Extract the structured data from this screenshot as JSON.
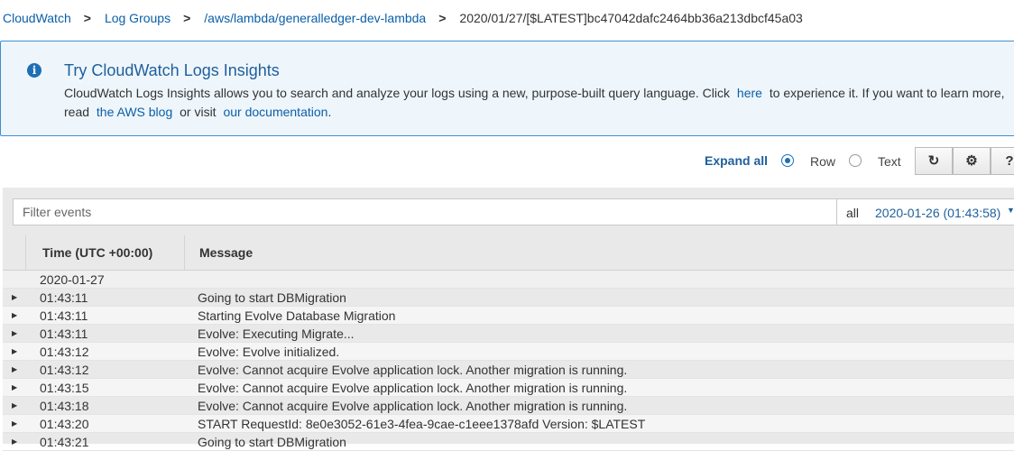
{
  "breadcrumb": {
    "items": [
      "CloudWatch",
      "Log Groups",
      "/aws/lambda/generalledger-dev-lambda"
    ],
    "current": "2020/01/27/[$LATEST]bc47042dafc2464bb36a213dbcf45a03",
    "separator": ">"
  },
  "banner": {
    "icon": "info-icon",
    "title": "Try CloudWatch Logs Insights",
    "text_1": "CloudWatch Logs Insights allows you to search and analyze your logs using a new, purpose-built query language. Click",
    "link_here": "here",
    "text_2": "to experience it. If you want to learn more,",
    "text_3": "read",
    "link_blog": "the AWS blog",
    "text_4": "or visit",
    "link_docs": "our documentation",
    "text_5": "."
  },
  "toolbar": {
    "expand_all": "Expand all",
    "view_options": [
      "Row",
      "Text"
    ],
    "selected_view": "Row",
    "buttons": [
      "refresh-icon",
      "gear-icon",
      "help-icon"
    ]
  },
  "filter": {
    "placeholder": "Filter events",
    "range_label": "all",
    "range_date": "2020-01-26 (01:43:58)"
  },
  "table": {
    "columns": [
      "Time (UTC +00:00)",
      "Message"
    ],
    "date_group": "2020-01-27",
    "rows": [
      {
        "time": "01:43:11",
        "message": "Going to start DBMigration"
      },
      {
        "time": "01:43:11",
        "message": "Starting Evolve Database Migration"
      },
      {
        "time": "01:43:11",
        "message": "Evolve: Executing Migrate..."
      },
      {
        "time": "01:43:12",
        "message": "Evolve: Evolve initialized."
      },
      {
        "time": "01:43:12",
        "message": "Evolve: Cannot acquire Evolve application lock. Another migration is running."
      },
      {
        "time": "01:43:15",
        "message": "Evolve: Cannot acquire Evolve application lock. Another migration is running."
      },
      {
        "time": "01:43:18",
        "message": "Evolve: Cannot acquire Evolve application lock. Another migration is running."
      },
      {
        "time": "01:43:20",
        "message": "START RequestId: 8e0e3052-61e3-4fea-9cae-c1eee1378afd Version: $LATEST"
      },
      {
        "time": "01:43:21",
        "message": "Going to start DBMigration"
      }
    ]
  },
  "colors": {
    "link": "#0a5fa8",
    "banner_bg": "#eef6fc",
    "banner_border": "#3f8fd2",
    "accent": "#1f6fb5"
  }
}
